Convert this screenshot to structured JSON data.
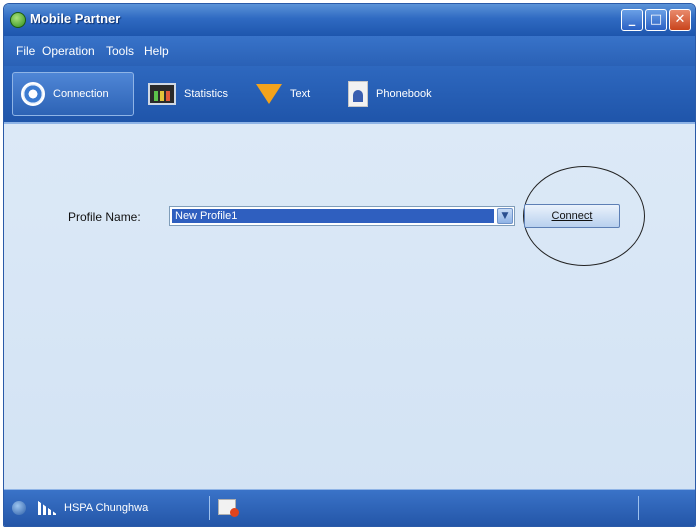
{
  "window": {
    "title": "Mobile Partner",
    "controls": {
      "minimize": "_",
      "maximize": "□",
      "close": "✕"
    }
  },
  "menu": {
    "items": [
      "File",
      "Operation",
      "Tools",
      "Help"
    ]
  },
  "toolbar": {
    "buttons": [
      {
        "label": "Connection",
        "icon": "connection-icon",
        "active": true
      },
      {
        "label": "Statistics",
        "icon": "statistics-icon",
        "active": false
      },
      {
        "label": "Text",
        "icon": "text-message-icon",
        "active": false
      },
      {
        "label": "Phonebook",
        "icon": "phonebook-icon",
        "active": false
      }
    ]
  },
  "main": {
    "profile_label": "Profile Name:",
    "profile_value": "New Profile1",
    "connect_label": "Connect"
  },
  "status": {
    "network": "HSPA Chunghwa"
  },
  "colors": {
    "chrome_blue": "#2a61b6",
    "content_bg": "#dbe8f6",
    "selection": "#2f5fbf"
  }
}
